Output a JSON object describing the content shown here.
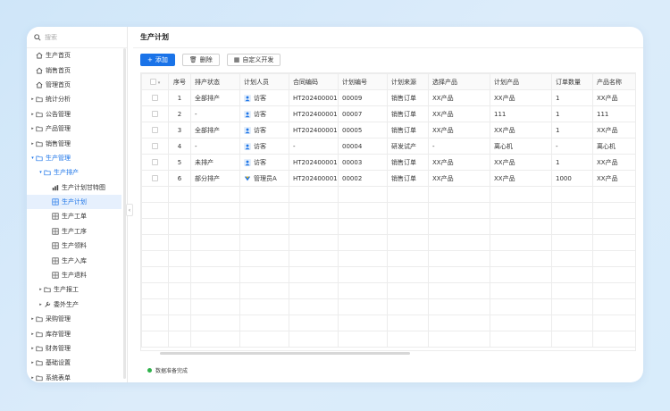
{
  "search": {
    "placeholder": "搜索"
  },
  "sidebar": {
    "items": [
      {
        "label": "生产首页",
        "level": 0,
        "icon": "home-icon",
        "arrow": ""
      },
      {
        "label": "销售首页",
        "level": 0,
        "icon": "home-icon",
        "arrow": ""
      },
      {
        "label": "管理首页",
        "level": 0,
        "icon": "home-icon",
        "arrow": ""
      },
      {
        "label": "统计分析",
        "level": 0,
        "icon": "folder-icon",
        "arrow": "▸"
      },
      {
        "label": "公告管理",
        "level": 0,
        "icon": "folder-icon",
        "arrow": "▸"
      },
      {
        "label": "产品管理",
        "level": 0,
        "icon": "folder-icon",
        "arrow": "▸"
      },
      {
        "label": "销售管理",
        "level": 0,
        "icon": "folder-icon",
        "arrow": "▸"
      },
      {
        "label": "生产管理",
        "level": 0,
        "icon": "folder-icon",
        "arrow": "▾",
        "open": true
      },
      {
        "label": "生产排产",
        "level": 1,
        "icon": "folder-icon",
        "arrow": "▾",
        "open": true
      },
      {
        "label": "生产计划甘特图",
        "level": 2,
        "icon": "chart-icon",
        "arrow": ""
      },
      {
        "label": "生产计划",
        "level": 2,
        "icon": "form-icon",
        "arrow": "",
        "active": true
      },
      {
        "label": "生产工单",
        "level": 2,
        "icon": "form-icon",
        "arrow": ""
      },
      {
        "label": "生产工序",
        "level": 2,
        "icon": "form-icon",
        "arrow": ""
      },
      {
        "label": "生产领料",
        "level": 2,
        "icon": "form-icon",
        "arrow": ""
      },
      {
        "label": "生产入库",
        "level": 2,
        "icon": "form-icon",
        "arrow": ""
      },
      {
        "label": "生产退料",
        "level": 2,
        "icon": "form-icon",
        "arrow": ""
      },
      {
        "label": "生产报工",
        "level": 1,
        "icon": "folder-icon",
        "arrow": "▸"
      },
      {
        "label": "委外生产",
        "level": 1,
        "icon": "wrench-icon",
        "arrow": "▸"
      },
      {
        "label": "采购管理",
        "level": 0,
        "icon": "folder-icon",
        "arrow": "▸"
      },
      {
        "label": "库存管理",
        "level": 0,
        "icon": "folder-icon",
        "arrow": "▸"
      },
      {
        "label": "财务管理",
        "level": 0,
        "icon": "folder-icon",
        "arrow": "▸"
      },
      {
        "label": "基础设置",
        "level": 0,
        "icon": "folder-icon",
        "arrow": "▸"
      },
      {
        "label": "系统表单",
        "level": 0,
        "icon": "folder-icon",
        "arrow": "▸"
      }
    ]
  },
  "header": {
    "title": "生产计划"
  },
  "toolbar": {
    "add_label": "添加",
    "delete_label": "删除",
    "custom_label": "自定义开发"
  },
  "table": {
    "columns": [
      "序号",
      "排产状态",
      "计划人员",
      "合同编码",
      "计划编号",
      "计划来源",
      "选择产品",
      "计划产品",
      "订单数量",
      "产品名称"
    ],
    "rows": [
      {
        "no": "1",
        "status": "全部排产",
        "person": "访客",
        "avatar": "user",
        "contract": "HT202400001",
        "plan": "00009",
        "source": "销售订单",
        "select": "XX产品",
        "product": "XX产品",
        "qty": "1",
        "name": "XX产品"
      },
      {
        "no": "2",
        "status": "-",
        "person": "访客",
        "avatar": "user",
        "contract": "HT202400001",
        "plan": "00007",
        "source": "销售订单",
        "select": "XX产品",
        "product": "111",
        "qty": "1",
        "name": "111"
      },
      {
        "no": "3",
        "status": "全部排产",
        "person": "访客",
        "avatar": "user",
        "contract": "HT202400001",
        "plan": "00005",
        "source": "销售订单",
        "select": "XX产品",
        "product": "XX产品",
        "qty": "1",
        "name": "XX产品"
      },
      {
        "no": "4",
        "status": "-",
        "person": "访客",
        "avatar": "user",
        "contract": "-",
        "plan": "00004",
        "source": "研发试产",
        "select": "-",
        "product": "离心机",
        "qty": "-",
        "name": "离心机"
      },
      {
        "no": "5",
        "status": "未排产",
        "person": "访客",
        "avatar": "user",
        "contract": "HT202400001",
        "plan": "00003",
        "source": "销售订单",
        "select": "XX产品",
        "product": "XX产品",
        "qty": "1",
        "name": "XX产品"
      },
      {
        "no": "6",
        "status": "部分排产",
        "person": "管理员A",
        "avatar": "admin",
        "contract": "HT202400001",
        "plan": "00002",
        "source": "销售订单",
        "select": "XX产品",
        "product": "XX产品",
        "qty": "1000",
        "name": "XX产品"
      }
    ]
  },
  "status": {
    "text": "数据准备完成"
  },
  "colors": {
    "accent": "#1a73e8",
    "ok": "#2fb24b"
  }
}
